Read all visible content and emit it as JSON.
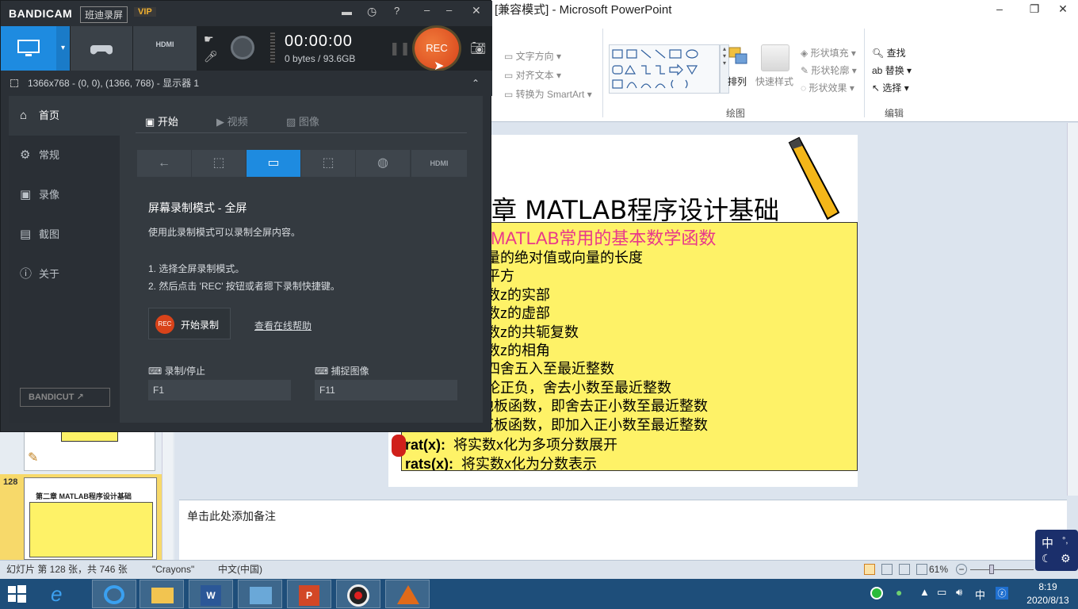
{
  "ppt": {
    "title": "[兼容模式] - Microsoft PowerPoint",
    "ribbon": {
      "text_direction": "文字方向",
      "align_text": "对齐文本",
      "convert_smartart": "转换为 SmartArt",
      "arrange": "排列",
      "quick_styles": "快速样式",
      "shape_fill": "形状填充",
      "shape_outline": "形状轮廓",
      "shape_effects": "形状效果",
      "drawing_group": "绘图",
      "find": "查找",
      "replace": "替换",
      "select": "选择",
      "edit_group": "编辑"
    },
    "slide": {
      "title": "章 MATLAB程序设计基础",
      "subtitle": "MATLAB常用的基本数学函数",
      "lines": [
        "量的绝对值或向量的长度",
        "平方",
        "数z的实部",
        "数z的虚部",
        "数z的共轭复数",
        "数z的相角",
        "四舍五入至最近整数",
        "论正负，舍去小数至最近整数",
        "地板函数，即舍去正小数至最近整数",
        "花板函数，即加入正小数至最近整数"
      ],
      "bold_lines": [
        {
          "fn": "rat(x):",
          "desc": "将实数x化为多项分数展开"
        },
        {
          "fn": "rats(x):",
          "desc": "将实数x化为分数表示"
        }
      ]
    },
    "notes_placeholder": "单击此处添加备注",
    "thumbnail": {
      "number": "128",
      "title": "第二章 MATLAB程序设计基础"
    },
    "status": {
      "slide_info": "幻灯片 第 128 张，共 746 张",
      "theme": "\"Crayons\"",
      "language": "中文(中国)",
      "zoom": "61%"
    }
  },
  "bandicam": {
    "logo": "BANDICAM",
    "brand_cn": "班迪录屏",
    "vip": "VIP",
    "timer": "00:00:00",
    "size": "0 bytes / 93.6GB",
    "rec_label": "REC",
    "hdmi_label": "HDMI",
    "resolution": "1366x768 - (0, 0), (1366, 768) - 显示器 1",
    "sidebar": [
      {
        "label": "首页",
        "icon": "home-icon"
      },
      {
        "label": "常规",
        "icon": "gear-icon"
      },
      {
        "label": "录像",
        "icon": "video-icon"
      },
      {
        "label": "截图",
        "icon": "image-icon"
      },
      {
        "label": "关于",
        "icon": "info-icon"
      }
    ],
    "bandicut": "BANDICUT",
    "tabs": [
      "开始",
      "视频",
      "图像"
    ],
    "mode_title": "屏幕录制模式 - 全屏",
    "mode_desc": "使用此录制模式可以录制全屏内容。",
    "step1": "1. 选择全屏录制模式。",
    "step2": "2. 然后点击 'REC' 按钮或者摁下录制快捷键。",
    "start_record": "开始录制",
    "help_link": "查看在线帮助",
    "hotkey_record_label": "录制/停止",
    "hotkey_record_value": "F1",
    "hotkey_capture_label": "捕捉图像",
    "hotkey_capture_value": "F11"
  },
  "taskbar": {
    "time": "8:19",
    "date": "2020/8/13",
    "ime": "中",
    "ime_badge": "中"
  },
  "colors": {
    "bandicam_accent": "#1e8be0",
    "rec_orange": "#e8561e",
    "slide_yellow": "#fef267",
    "subtitle_pink": "#e8388a"
  }
}
